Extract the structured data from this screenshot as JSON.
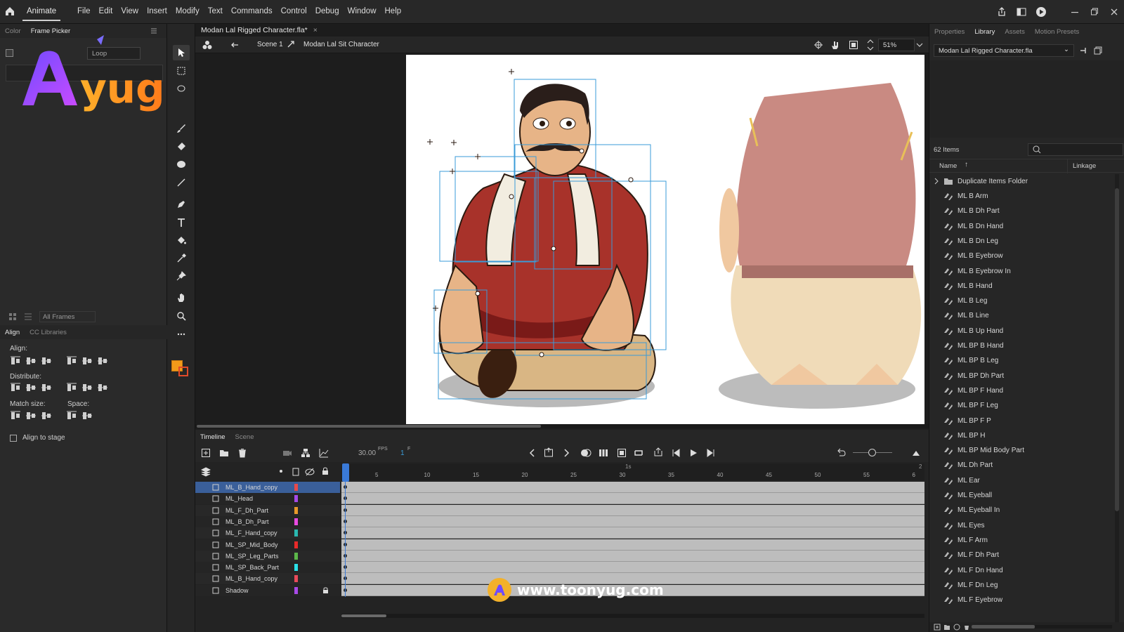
{
  "app": {
    "name": "Animate"
  },
  "menu": [
    "File",
    "Edit",
    "View",
    "Insert",
    "Modify",
    "Text",
    "Commands",
    "Control",
    "Debug",
    "Window",
    "Help"
  ],
  "left_panel": {
    "tabs": [
      "Color",
      "Frame Picker"
    ],
    "loop_label": "Loop",
    "frames_dropdown": "All Frames",
    "align_tabs": [
      "Align",
      "CC Libraries"
    ],
    "align_label": "Align:",
    "distribute_label": "Distribute:",
    "match_size_label": "Match size:",
    "space_label": "Space:",
    "align_to_stage_label": "Align to stage"
  },
  "document": {
    "tab_title": "Modan Lal Rigged Character.fla*",
    "scene": "Scene 1",
    "symbol": "Modan Lal Sit Character",
    "zoom": "51%"
  },
  "timeline": {
    "tabs": [
      "Timeline",
      "Scene"
    ],
    "fps": "30.00",
    "fps_label": "FPS",
    "frame": "1",
    "frame_suffix": "F",
    "ruler": [
      "1s",
      "2"
    ],
    "ticks": [
      "5",
      "10",
      "15",
      "20",
      "25",
      "30",
      "35",
      "40",
      "45",
      "50",
      "55",
      "6"
    ],
    "layers": [
      {
        "name": "ML_B_Hand_copy",
        "color": "#e84a4a",
        "selected": true
      },
      {
        "name": "ML_Head",
        "color": "#a54ae8"
      },
      {
        "name": "ML_F_Dh_Part",
        "color": "#e89a2a"
      },
      {
        "name": "ML_B_Dh_Part",
        "color": "#e84ae0"
      },
      {
        "name": "ML_F_Hand_copy",
        "color": "#2ab8b0"
      },
      {
        "name": "ML_SP_Mid_Body",
        "color": "#e82a2a"
      },
      {
        "name": "ML_SP_Leg_Parts",
        "color": "#5cb84a"
      },
      {
        "name": "ML_SP_Back_Part",
        "color": "#2ae0e8"
      },
      {
        "name": "ML_B_Hand_copy",
        "color": "#e84a5a"
      },
      {
        "name": "Shadow",
        "color": "#a84ae8"
      }
    ]
  },
  "right_panel": {
    "tabs": [
      "Properties",
      "Library",
      "Assets",
      "Motion Presets"
    ],
    "library_file": "Modan Lal Rigged Character.fla",
    "items_count": "62 Items",
    "col_name": "Name",
    "col_linkage": "Linkage",
    "folder": "Duplicate Items Folder",
    "items": [
      "ML B Arm",
      "ML B Dh Part",
      "ML B Dn Hand",
      "ML B Dn Leg",
      "ML B Eyebrow",
      "ML B Eyebrow In",
      "ML B Hand",
      "ML B Leg",
      "ML B Line",
      "ML B Up Hand",
      "ML BP B Hand",
      "ML BP B Leg",
      "ML BP Dh Part",
      "ML BP F Hand",
      "ML BP F Leg",
      "ML BP F P",
      "ML BP H",
      "ML BP Mid Body Part",
      "ML Dh Part",
      "ML Ear",
      "ML Eyeball",
      "ML Eyeball In",
      "ML Eyes",
      "ML F Arm",
      "ML F Dh Part",
      "ML F Dn Hand",
      "ML F Dn Leg",
      "ML F Eyebrow"
    ]
  },
  "branding": {
    "logo_text": "Ayug",
    "url": "www.toonyug.com"
  },
  "colors": {
    "fill": "#f29a1a",
    "stroke": "#e04a2a",
    "selection": "#3a6ea5"
  }
}
